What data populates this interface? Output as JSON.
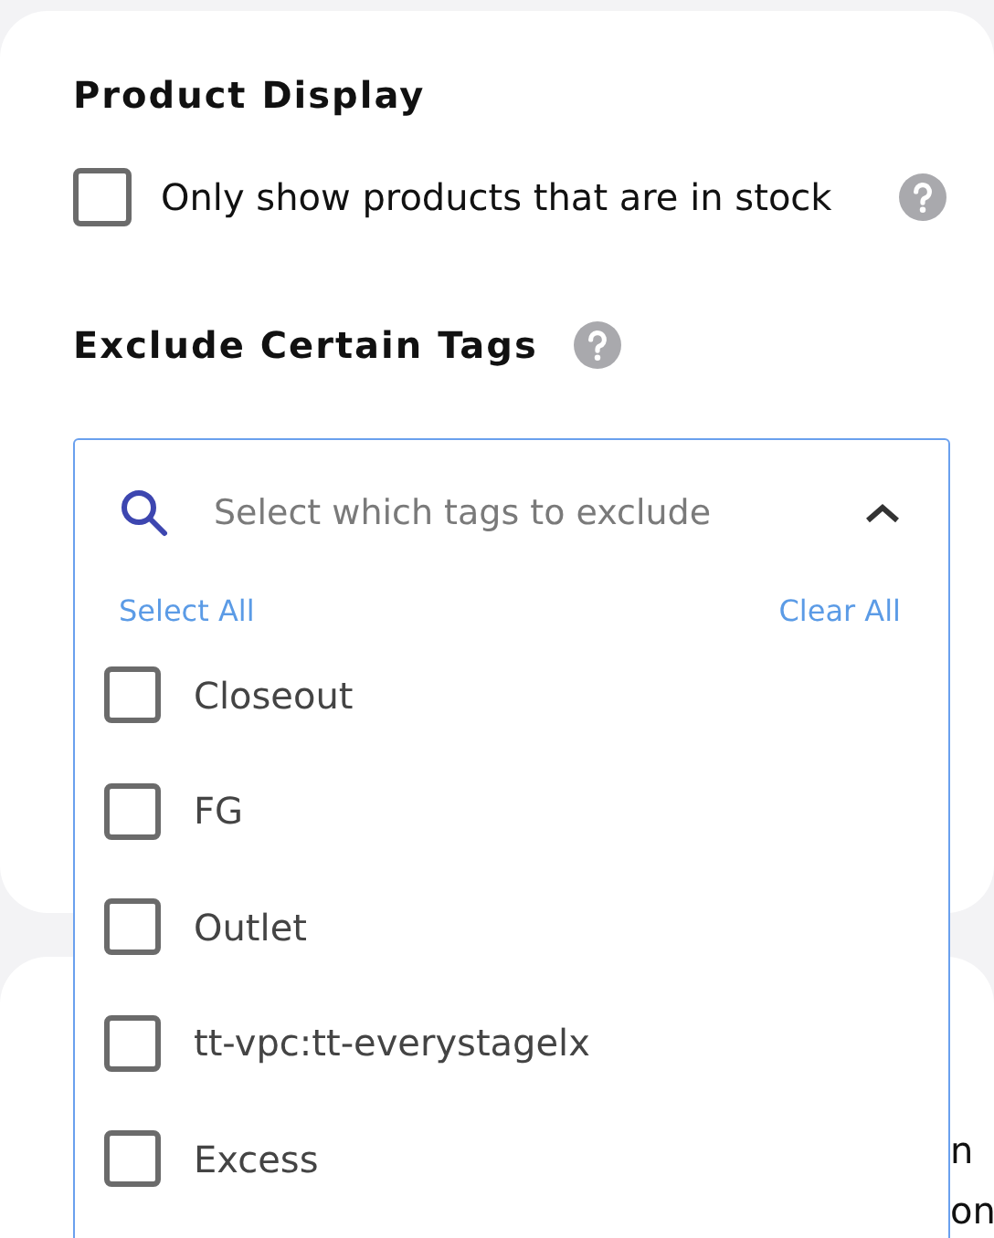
{
  "product_display": {
    "title": "Product Display",
    "option": {
      "label": "Only show products that are in stock",
      "checked": false
    }
  },
  "exclude_tags": {
    "title": "Exclude Certain Tags",
    "search": {
      "placeholder": "Select which tags to exclude"
    },
    "expanded": true,
    "select_all": "Select All",
    "clear_all": "Clear All",
    "tags": [
      {
        "label": "Closeout",
        "checked": false
      },
      {
        "label": "FG",
        "checked": false
      },
      {
        "label": "Outlet",
        "checked": false
      },
      {
        "label": "tt-vpc:tt-everystagelx",
        "checked": false
      },
      {
        "label": "Excess",
        "checked": false
      }
    ]
  },
  "next_card": {
    "text_lines": [
      "n",
      "on"
    ]
  }
}
